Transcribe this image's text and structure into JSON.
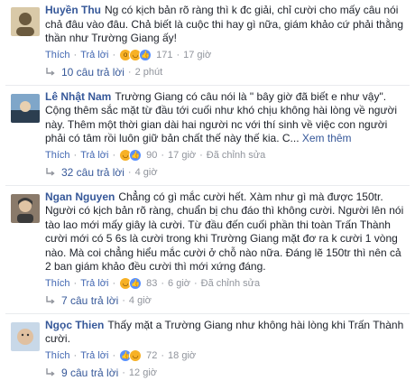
{
  "labels": {
    "like": "Thích",
    "reply": "Trả lời",
    "edited": "Đã chỉnh sửa",
    "see_more": "Xem thêm"
  },
  "comments": [
    {
      "name": "Huyền Thu",
      "text": "Ng có kịch bản rõ ràng thì k đc giải, chỉ cười cho mấy câu nói chả đâu vào đâu. Chả biết là cuộc thi hay gì nữa, giám khảo cứ phải thằng thần như Trường Giang ấy!",
      "see_more": false,
      "reactions": 171,
      "time": "17 giờ",
      "edited": false,
      "replies_label": "10 câu trả lời",
      "replies_ago": "2 phút",
      "avatar_colors": [
        "#6b5a3e",
        "#d9c9a8"
      ]
    },
    {
      "name": "Lê Nhật Nam",
      "text": "Trường Giang có câu nói là \" bây giờ đã biết e như vậy\". Cộng thêm sắc mặt từ đầu tới cuối như khó chịu không hài lòng về người này. Thêm một thời gian dài hai người nc với thí sinh về việc con người phải có tâm rồi luôn giữ bản chất thế này thế kia. C... ",
      "see_more": true,
      "reactions": 90,
      "time": "17 giờ",
      "edited": true,
      "replies_label": "32 câu trả lời",
      "replies_ago": "4 giờ",
      "avatar_colors": [
        "#7fa6c9",
        "#2c3e50"
      ]
    },
    {
      "name": "Ngan Nguyen",
      "text": "Chẳng có gì mắc cười hết. Xàm như gì mà được 150tr. Người có kịch bản rõ ràng, chuẩn bị chu đáo thì không cười. Người lên nói tào lao mới mấy giây là cười. Từ đầu đến cuối phần thi toàn Trấn Thành cười mới có 5 6s là cười trong khi Trường Giang mặt đơ ra k cười 1 vòng nào. Mà coi chẳng hiểu mắc cười ở chỗ nào nữa. Đáng lẽ 150tr thì nên cả 2 ban giám khảo đều cười thì mới xứng đáng.",
      "see_more": false,
      "reactions": 83,
      "time": "6 giờ",
      "edited": true,
      "replies_label": "7 câu trả lời",
      "replies_ago": "4 giờ",
      "avatar_colors": [
        "#8a7a6a",
        "#3a3a3a"
      ]
    },
    {
      "name": "Ngọc Thien",
      "text": "Thấy mặt a Trường Giang như không hài lòng khi Trấn Thành cười.",
      "see_more": false,
      "reactions": 72,
      "time": "18 giờ",
      "edited": false,
      "replies_label": "9 câu trả lời",
      "replies_ago": "12 giờ",
      "avatar_colors": [
        "#c8d8e8",
        "#e0c0a0"
      ]
    }
  ]
}
